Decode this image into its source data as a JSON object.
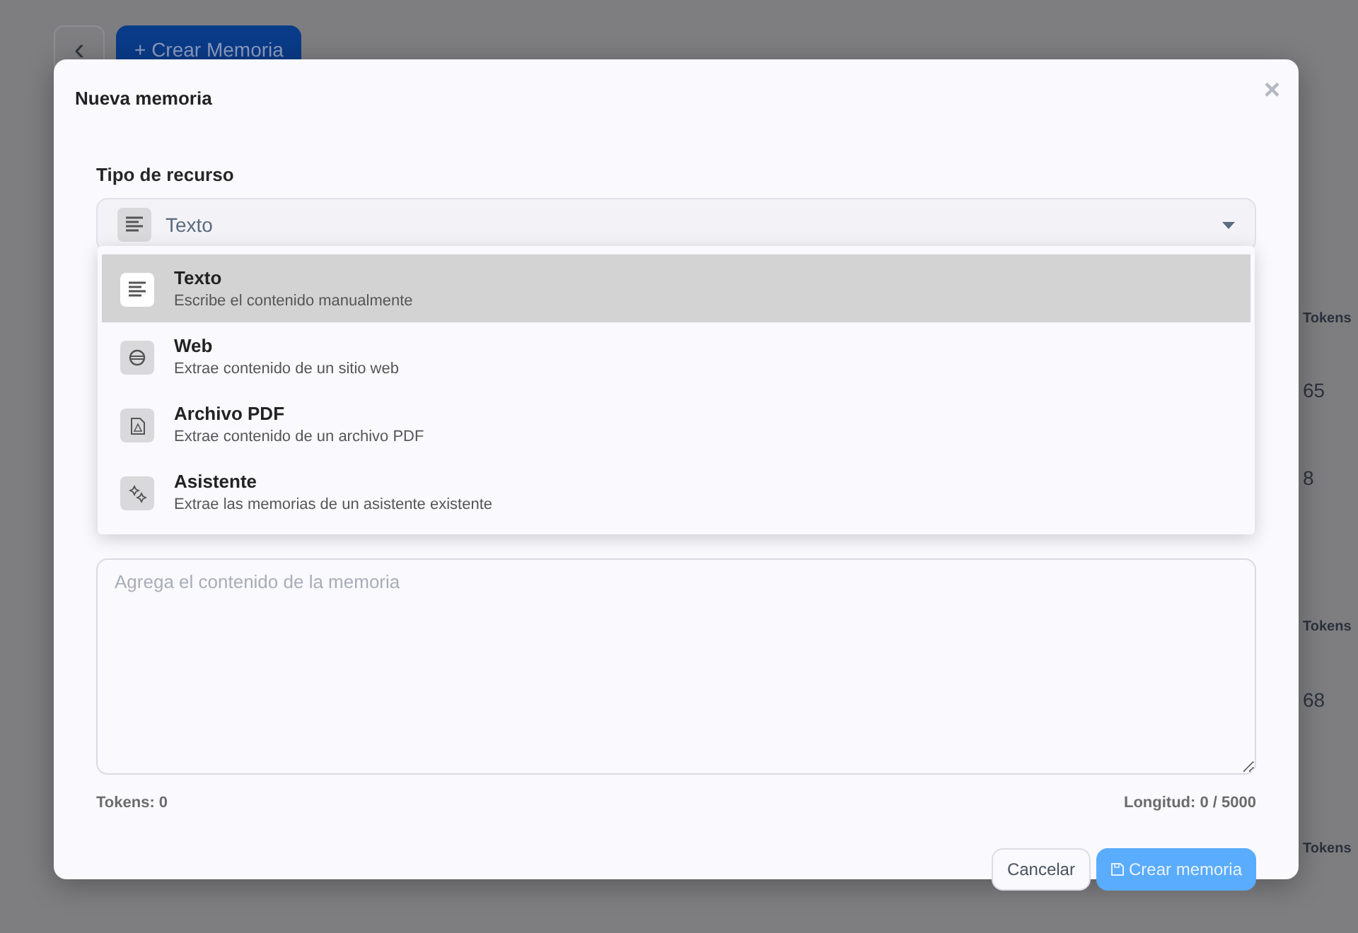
{
  "background_page": {
    "back_button": "‹",
    "create_button": {
      "icon": "+",
      "label": "Crear Memoria"
    },
    "right_column": [
      {
        "kind": "header",
        "text": "Tokens"
      },
      {
        "kind": "value",
        "text": "65"
      },
      {
        "kind": "value",
        "text": "8"
      },
      {
        "kind": "header",
        "text": "Tokens"
      },
      {
        "kind": "value",
        "text": "68"
      },
      {
        "kind": "header",
        "text": "Tokens"
      }
    ]
  },
  "modal": {
    "title": "Nueva memoria",
    "close": "×",
    "resource_type": {
      "label": "Tipo de recurso",
      "value": "Texto",
      "expanded": true,
      "options": [
        {
          "kind": "text",
          "label": "Texto",
          "description": "Escribe el contenido manualmente",
          "selected": true
        },
        {
          "kind": "web",
          "label": "Web",
          "description": "Extrae contenido de un sitio web",
          "selected": false
        },
        {
          "kind": "pdf",
          "label": "Archivo PDF",
          "description": "Extrae contenido de un archivo PDF",
          "selected": false
        },
        {
          "kind": "assistant",
          "label": "Asistente",
          "description": "Extrae las memorias de un asistente existente",
          "selected": false
        }
      ]
    },
    "content": {
      "placeholder": "Agrega el contenido de la memoria"
    },
    "tokens": {
      "label": "Tokens:",
      "value": "0"
    },
    "length": {
      "label": "Longitud:",
      "value": "0 / 5000"
    },
    "buttons": [
      {
        "kind": "secondary",
        "label": "Cancelar",
        "disabled": false
      },
      {
        "kind": "primary",
        "label": "Crear memoria",
        "disabled": true
      }
    ]
  }
}
